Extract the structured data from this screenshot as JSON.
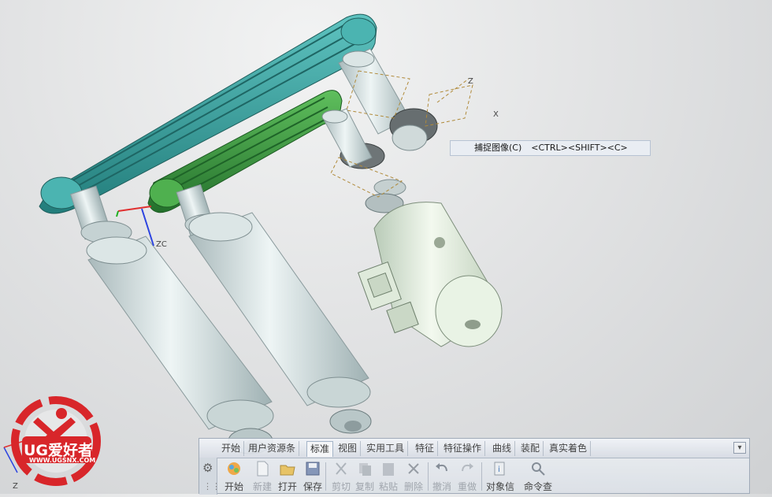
{
  "viewport": {
    "tooltip": {
      "label": "捕捉图像(C)",
      "shortcut": "<CTRL><SHIFT><C>"
    },
    "axis_labels": {
      "zc": "ZC",
      "z_bottom": "Z",
      "z_top": "Z",
      "x": "X"
    }
  },
  "watermark": {
    "brand": "UG爱好者",
    "url": "WWW.UGSNX.COM"
  },
  "ribbon": {
    "tabs": [
      "开始",
      "用户资源条",
      "标准",
      "视图",
      "实用工具",
      "特征",
      "特征操作",
      "曲线",
      "装配",
      "真实着色"
    ],
    "active_tab": "标准",
    "tools": [
      {
        "label": "开始",
        "icon": "start-icon"
      },
      {
        "label": "新建",
        "icon": "new-file-icon"
      },
      {
        "label": "打开",
        "icon": "open-folder-icon"
      },
      {
        "label": "保存",
        "icon": "save-icon"
      },
      {
        "label": "剪切",
        "icon": "cut-icon"
      },
      {
        "label": "复制",
        "icon": "copy-icon"
      },
      {
        "label": "粘贴",
        "icon": "paste-icon"
      },
      {
        "label": "删除",
        "icon": "delete-icon"
      },
      {
        "label": "撤消",
        "icon": "undo-icon"
      },
      {
        "label": "重做",
        "icon": "redo-icon"
      },
      {
        "label": "对象信",
        "icon": "object-info-icon"
      },
      {
        "label": "命令查",
        "icon": "command-finder-icon"
      }
    ]
  },
  "colors": {
    "belt_large": "#3aa6a4",
    "belt_small": "#3f9a4a",
    "roller": "#d7e4e4",
    "motor": "#e4f0e0",
    "gear": "#6c7375",
    "watermark_red": "#d8262a"
  }
}
